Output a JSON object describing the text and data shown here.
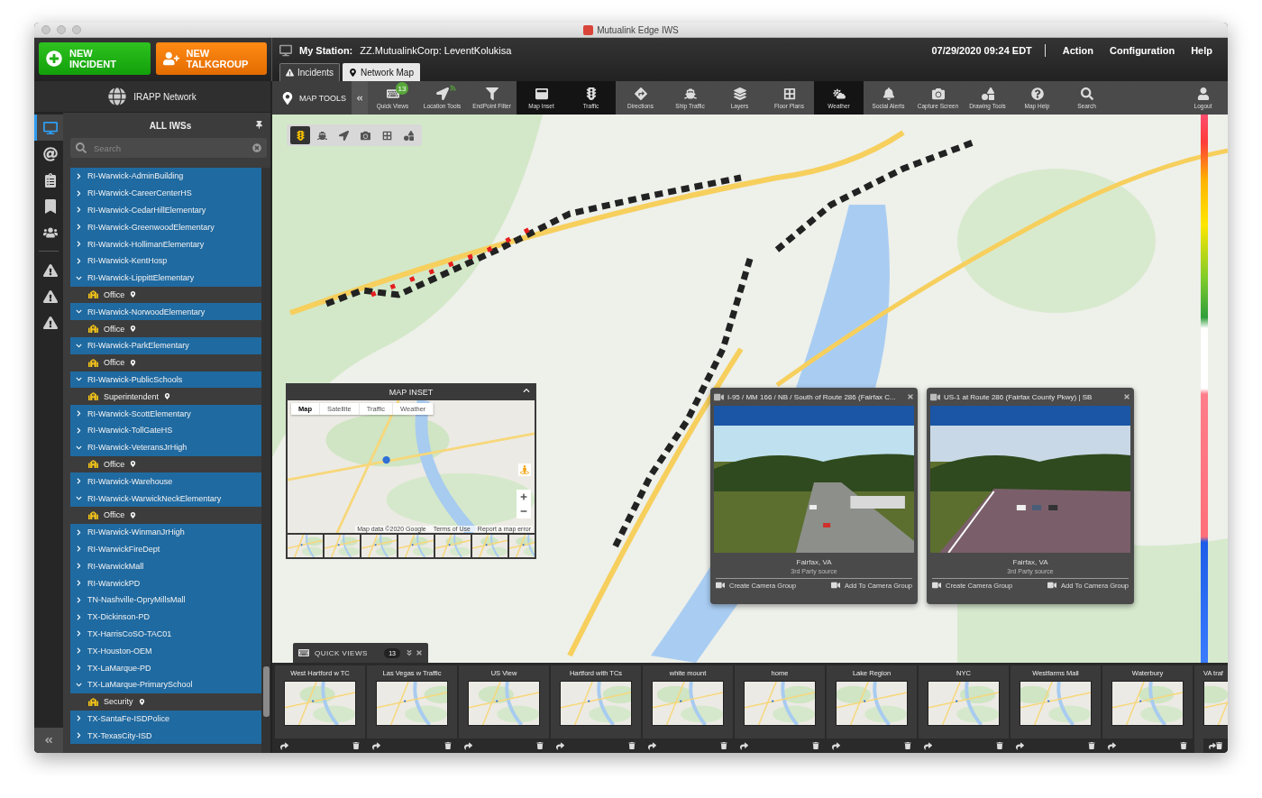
{
  "window": {
    "title": "Mutualink Edge IWS"
  },
  "header": {
    "buttons": [
      {
        "kind": "incident",
        "label": "NEW INCIDENT"
      },
      {
        "kind": "talkgroup",
        "label": "NEW TALKGROUP"
      }
    ],
    "station_label": "My Station:",
    "station": "ZZ.MutualinkCorp: LeventKolukisa",
    "datetime": "07/29/2020 09:24 EDT",
    "menu": [
      "Action",
      "Configuration",
      "Help"
    ]
  },
  "tabs": [
    {
      "kind": "warning",
      "label": "Incidents",
      "selected": false
    },
    {
      "kind": "pin",
      "label": "Network Map",
      "selected": true
    }
  ],
  "sidebar": {
    "network": "IRAPP Network",
    "rail": [
      {
        "kind": "monitors",
        "selected": true
      },
      {
        "kind": "at",
        "selected": false
      },
      {
        "kind": "clipboard",
        "selected": false
      },
      {
        "kind": "bookmark",
        "selected": false
      },
      {
        "kind": "group",
        "selected": false
      },
      {
        "kind": "alert-bolt",
        "selected": false
      },
      {
        "kind": "alert-mail",
        "selected": false
      },
      {
        "kind": "alert-minus",
        "selected": false
      }
    ],
    "title": "ALL IWSs",
    "search": {
      "placeholder": "Search"
    },
    "items": [
      {
        "label": "RI-Warwick-AdminBuilding",
        "expanded": false
      },
      {
        "label": "RI-Warwick-CareerCenterHS",
        "expanded": false
      },
      {
        "label": "RI-Warwick-CedarHillElementary",
        "expanded": false
      },
      {
        "label": "RI-Warwick-GreenwoodElementary",
        "expanded": false
      },
      {
        "label": "RI-Warwick-HollimanElementary",
        "expanded": false
      },
      {
        "label": "RI-Warwick-KentHosp",
        "expanded": false
      },
      {
        "label": "RI-Warwick-LippittElementary",
        "expanded": true,
        "children": [
          {
            "label": "Office"
          }
        ]
      },
      {
        "label": "RI-Warwick-NorwoodElementary",
        "expanded": true,
        "children": [
          {
            "label": "Office"
          }
        ]
      },
      {
        "label": "RI-Warwick-ParkElementary",
        "expanded": true,
        "children": [
          {
            "label": "Office"
          }
        ]
      },
      {
        "label": "RI-Warwick-PublicSchools",
        "expanded": true,
        "children": [
          {
            "label": "Superintendent"
          }
        ]
      },
      {
        "label": "RI-Warwick-ScottElementary",
        "expanded": false
      },
      {
        "label": "RI-Warwick-TollGateHS",
        "expanded": false
      },
      {
        "label": "RI-Warwick-VeteransJrHigh",
        "expanded": true,
        "children": [
          {
            "label": "Office"
          }
        ]
      },
      {
        "label": "RI-Warwick-Warehouse",
        "expanded": false
      },
      {
        "label": "RI-Warwick-WarwickNeckElementary",
        "expanded": true,
        "children": [
          {
            "label": "Office"
          }
        ]
      },
      {
        "label": "RI-Warwick-WinmanJrHigh",
        "expanded": false
      },
      {
        "label": "RI-WarwickFireDept",
        "expanded": false
      },
      {
        "label": "RI-WarwickMall",
        "expanded": false
      },
      {
        "label": "RI-WarwickPD",
        "expanded": false
      },
      {
        "label": "TN-Nashville-OpryMillsMall",
        "expanded": false
      },
      {
        "label": "TX-Dickinson-PD",
        "expanded": false
      },
      {
        "label": "TX-HarrisCoSO-TAC01",
        "expanded": false
      },
      {
        "label": "TX-Houston-OEM",
        "expanded": false
      },
      {
        "label": "TX-LaMarque-PD",
        "expanded": false
      },
      {
        "label": "TX-LaMarque-PrimarySchool",
        "expanded": true,
        "children": [
          {
            "label": "Security"
          }
        ]
      },
      {
        "label": "TX-SantaFe-ISDPolice",
        "expanded": false
      },
      {
        "label": "TX-TexasCity-ISD",
        "expanded": false
      }
    ]
  },
  "map_tools": {
    "label": "MAP TOOLS",
    "logout": "Logout",
    "tools": [
      {
        "kind": "quick-views",
        "label": "Quick Views",
        "selected": false,
        "badge": "13"
      },
      {
        "kind": "location",
        "label": "Location Tools",
        "selected": false
      },
      {
        "kind": "filter",
        "label": "EndPoint Filter",
        "selected": false
      },
      {
        "kind": "inset",
        "label": "Map Inset",
        "selected": true
      },
      {
        "kind": "traffic",
        "label": "Traffic",
        "selected": true
      },
      {
        "kind": "directions",
        "label": "Directions",
        "selected": false
      },
      {
        "kind": "ship",
        "label": "Ship Traffic",
        "selected": false
      },
      {
        "kind": "layers",
        "label": "Layers",
        "selected": false
      },
      {
        "kind": "floor",
        "label": "Floor Plans",
        "selected": false
      },
      {
        "kind": "weather",
        "label": "Weather",
        "selected": true
      },
      {
        "kind": "bell",
        "label": "Social Alerts",
        "selected": false
      },
      {
        "kind": "capture",
        "label": "Capture Screen",
        "selected": false
      },
      {
        "kind": "drawing",
        "label": "Drawing Tools",
        "selected": false
      },
      {
        "kind": "help",
        "label": "Map Help",
        "selected": false
      },
      {
        "kind": "search",
        "label": "Search",
        "selected": false
      }
    ]
  },
  "map_toolbar": [
    {
      "kind": "traffic",
      "selected": true
    },
    {
      "kind": "ship",
      "selected": false
    },
    {
      "kind": "location",
      "selected": false
    },
    {
      "kind": "camera",
      "selected": false
    },
    {
      "kind": "grid",
      "selected": false
    },
    {
      "kind": "shapes",
      "selected": false
    }
  ],
  "map_inset": {
    "title": "MAP INSET",
    "tabs": [
      {
        "label": "Map",
        "selected": true
      },
      {
        "label": "Satellite",
        "selected": false
      },
      {
        "label": "Traffic",
        "selected": false
      },
      {
        "label": "Weather",
        "selected": false
      }
    ],
    "attribution": [
      "Map data ©2020 Google",
      "Terms of Use",
      "Report a map error"
    ]
  },
  "cameras": [
    {
      "title": "I-95 / MM 166 / NB / South of Route 286 (Fairfax C...",
      "location": "Fairfax, VA",
      "source": "3rd Party source",
      "actions": [
        "Create Camera Group",
        "Add To Camera Group"
      ]
    },
    {
      "title": "US-1 at Route 286 (Fairfax County Pkwy) | SB",
      "location": "Fairfax, VA",
      "source": "3rd Party source",
      "actions": [
        "Create Camera Group",
        "Add To Camera Group"
      ]
    }
  ],
  "quick_views": {
    "title": "QUICK VIEWS",
    "count": "13",
    "items": [
      "West Hartford w TC",
      "Las Vegas w Traffic",
      "US View",
      "Hartford with TCs",
      "white mount",
      "home",
      "Lake Region",
      "NYC",
      "Westfarms Mall",
      "Waterbury",
      "VA traf"
    ]
  }
}
